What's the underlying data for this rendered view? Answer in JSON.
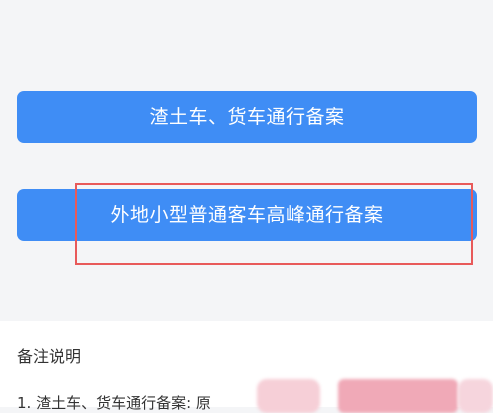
{
  "buttons": {
    "muck_truck_filing": "渣土车、货车通行备案",
    "nonlocal_small_car_filing": "外地小型普通客车高峰通行备案"
  },
  "notes": {
    "title": "备注说明",
    "item_1_partial": "1. 渣土车、货车通行备案: 原"
  },
  "colors": {
    "button_blue": "#3f8df5",
    "highlight_red": "#e85a5a"
  }
}
